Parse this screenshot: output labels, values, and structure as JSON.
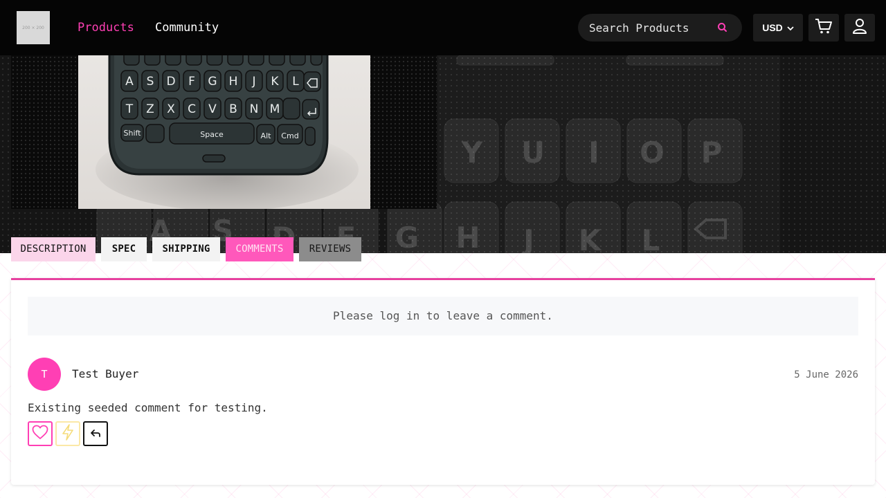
{
  "header": {
    "logo_text": "200 × 200",
    "nav": [
      {
        "label": "Products",
        "active": true
      },
      {
        "label": "Community",
        "active": false
      }
    ],
    "search_placeholder": "Search Products",
    "currency": "USD",
    "icons": {
      "search": "search-icon",
      "currency_caret": "chevron-down-icon",
      "cart": "cart-icon",
      "account": "user-icon"
    }
  },
  "hero": {
    "photo_keys_row2": [
      "A",
      "S",
      "D",
      "F",
      "G",
      "H",
      "J",
      "K",
      "L"
    ],
    "photo_keys_row3": [
      "T",
      "Z",
      "X",
      "C",
      "V",
      "B",
      "N",
      "M"
    ],
    "photo_keys_bottom": [
      "Shift",
      "Space",
      "Alt",
      "Cmd"
    ],
    "bg_keys_row1": [
      "Y",
      "U",
      "I",
      "O",
      "P"
    ],
    "bg_keys_row2": [
      "A",
      "S",
      "D",
      "F",
      "G",
      "H",
      "J",
      "K",
      "L"
    ]
  },
  "tabs": [
    {
      "label": "DESCRIPTION",
      "active": false
    },
    {
      "label": "SPEC",
      "active": false
    },
    {
      "label": "SHIPPING",
      "active": false
    },
    {
      "label": "COMMENTS",
      "active": true
    },
    {
      "label": "REVIEWS",
      "active": false
    }
  ],
  "comments": {
    "login_prompt": "Please log in to leave a comment.",
    "items": [
      {
        "avatar_initial": "T",
        "author": "Test Buyer",
        "date": "5 June 2026",
        "text": "Existing seeded comment for testing."
      }
    ],
    "action_icons": [
      "heart-icon",
      "lightning-icon",
      "reply-icon"
    ]
  },
  "colors": {
    "accent": "#ff3fb4",
    "header_bg": "#050505",
    "panel_border": "#e7419f"
  }
}
